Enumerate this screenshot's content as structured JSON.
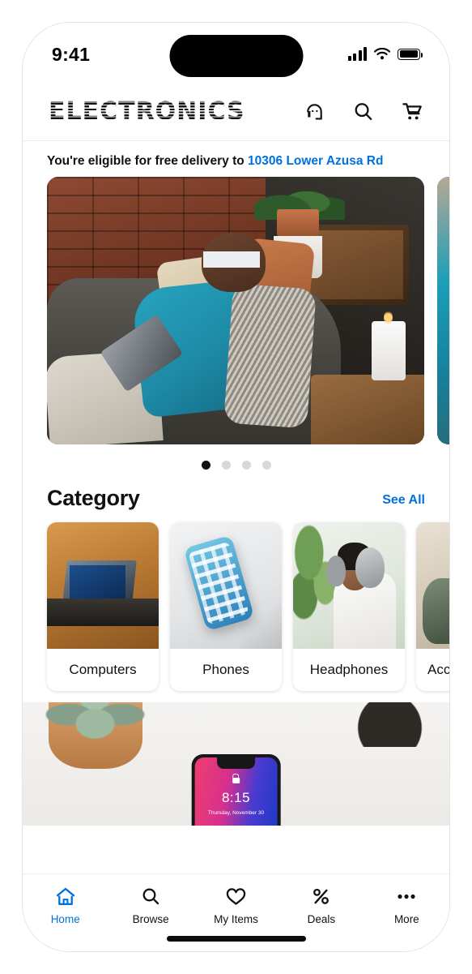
{
  "status_bar": {
    "time": "9:41",
    "icons": [
      "cellular-signal-icon",
      "wifi-icon",
      "battery-icon"
    ]
  },
  "header": {
    "brand": "ELECTRONICS",
    "actions": [
      {
        "name": "support-headset-icon",
        "label": "Support"
      },
      {
        "name": "search-icon",
        "label": "Search"
      },
      {
        "name": "cart-icon",
        "label": "Cart"
      }
    ]
  },
  "delivery": {
    "prefix": "You're eligible for free delivery to ",
    "address": "10306 Lower Azusa Rd",
    "link_color": "#0071dc"
  },
  "hero": {
    "slides": [
      {
        "alt": "Person relaxing on couch with tablet"
      },
      {
        "alt": "Teal product banner"
      }
    ],
    "dots": 4,
    "active_dot": 0
  },
  "category": {
    "title": "Category",
    "see_all": "See All",
    "items": [
      {
        "label": "Computers",
        "image": "laptop-on-wooden-desk"
      },
      {
        "label": "Phones",
        "image": "smartphone-beside-laptop"
      },
      {
        "label": "Headphones",
        "image": "woman-wearing-headphones"
      },
      {
        "label": "Accessories",
        "image": "accessories-flatlay"
      }
    ]
  },
  "promo": {
    "alt": "Phone lock screen beside succulent plant",
    "lock_time": "8:15",
    "lock_date": "Thursday, November 30"
  },
  "tabbar": {
    "items": [
      {
        "label": "Home",
        "icon": "home-icon",
        "active": true
      },
      {
        "label": "Browse",
        "icon": "search-icon",
        "active": false
      },
      {
        "label": "My Items",
        "icon": "heart-icon",
        "active": false
      },
      {
        "label": "Deals",
        "icon": "percent-icon",
        "active": false
      },
      {
        "label": "More",
        "icon": "ellipsis-icon",
        "active": false
      }
    ],
    "active_color": "#0071dc"
  }
}
